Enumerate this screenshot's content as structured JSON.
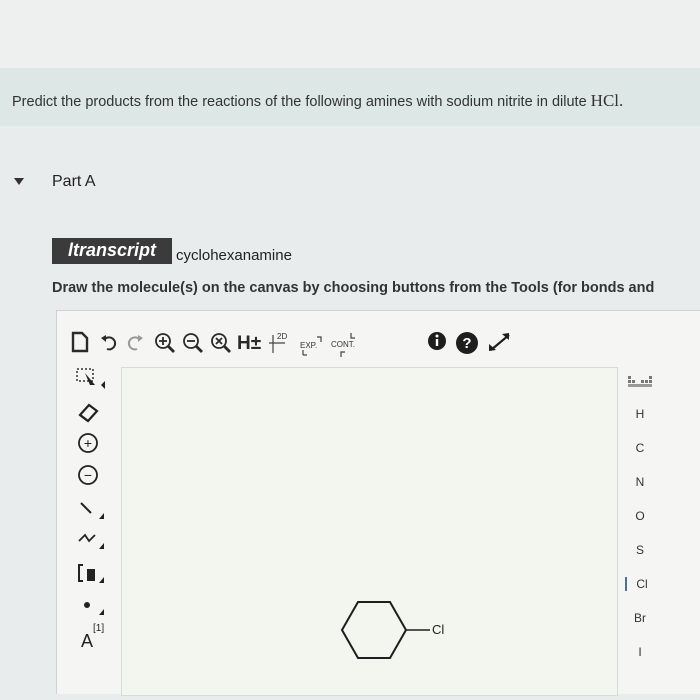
{
  "question": {
    "text": "Predict the products from the reactions of the following amines with sodium nitrite in dilute",
    "formula": "HCl."
  },
  "part": {
    "label": "Part A"
  },
  "transcript": {
    "badge": "ltranscript",
    "compound": "cyclohexanamine"
  },
  "instruction": "Draw the molecule(s) on the canvas by choosing buttons from the Tools (for bonds and",
  "toolbar": {
    "hplus": "H±",
    "exp_label": "EXP.",
    "cont_label": "CONT.",
    "twod_label": "2D"
  },
  "leftbar": {
    "charge_plus": "+",
    "charge_minus": "−",
    "atom_label": "A",
    "atom_index": "[1]"
  },
  "elements": [
    "H",
    "C",
    "N",
    "O",
    "S",
    "Cl",
    "Br",
    "I"
  ],
  "selected_element": "Cl",
  "molecule": {
    "substituent": "Cl"
  },
  "colors": {
    "accent": "#4a6fa5",
    "question_bg": "#dde7e6",
    "badge_bg": "#3b3b3b"
  }
}
